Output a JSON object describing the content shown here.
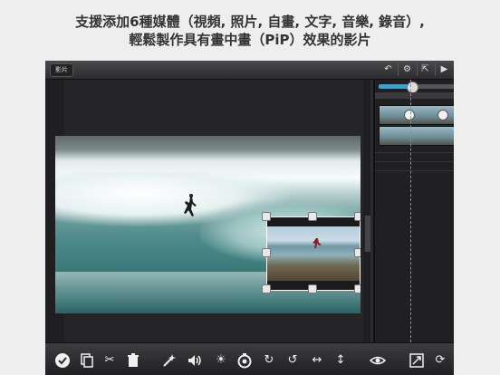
{
  "headline": {
    "line1": "支援添加6種媒體（視頻, 照片, 自畫, 文字, 音樂, 錄音）,",
    "line2": "輕鬆製作具有畫中畫（PiP）效果的影片"
  },
  "app": {
    "back_button": "影片",
    "toolbar": {
      "undo_icon": "undo-icon",
      "settings_icon": "gear-icon",
      "share_icon": "share-icon",
      "play_icon": "play-icon"
    },
    "timeline": {
      "accent": "#29a9e0",
      "zoom_level": 0.45
    },
    "bottom_tools": [
      "checkmark-icon",
      "copy-icon",
      "scissors-icon",
      "trash-icon",
      "magic-wand-icon",
      "volume-icon",
      "brightness-icon",
      "timer-icon",
      "rotate-clockwise-icon",
      "rotate-counterclockwise-icon",
      "flip-horizontal-icon",
      "flip-vertical-icon",
      "eye-icon",
      "fullscreen-icon",
      "refresh-icon"
    ]
  }
}
